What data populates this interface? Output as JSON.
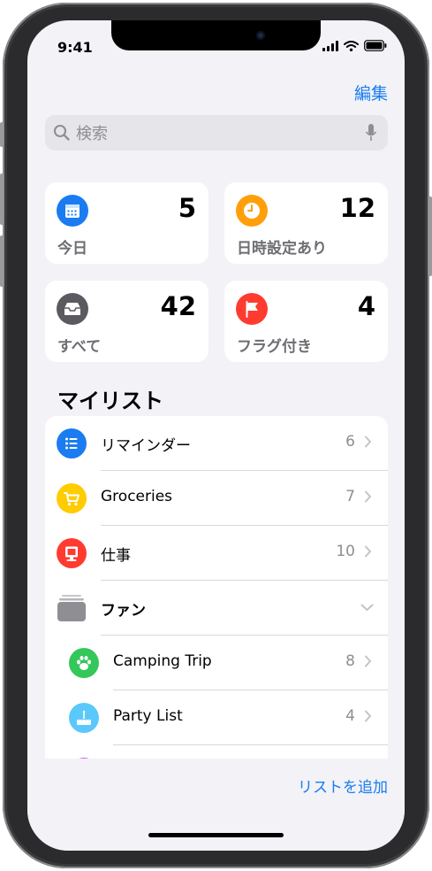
{
  "status_bar": {
    "time": "9:41"
  },
  "header": {
    "edit_label": "編集"
  },
  "search": {
    "placeholder": "検索"
  },
  "smart_lists": [
    {
      "label": "今日",
      "count": "5",
      "color": "#1a7cf0",
      "icon": "calendar-icon"
    },
    {
      "label": "日時設定あり",
      "count": "12",
      "color": "#ff9f0a",
      "icon": "clock-icon"
    },
    {
      "label": "すべて",
      "count": "42",
      "color": "#5a5a60",
      "icon": "tray-icon"
    },
    {
      "label": "フラグ付き",
      "count": "4",
      "color": "#ff3b30",
      "icon": "flag-icon"
    }
  ],
  "my_lists": {
    "title": "マイリスト",
    "items": [
      {
        "name": "リマインダー",
        "count": "6",
        "color": "#1a7cf0",
        "icon": "list-icon"
      },
      {
        "name": "Groceries",
        "count": "7",
        "color": "#ffcc00",
        "icon": "cart-icon"
      },
      {
        "name": "仕事",
        "count": "10",
        "color": "#ff3b30",
        "icon": "monitor-icon"
      }
    ],
    "group": {
      "name": "ファン",
      "icon": "folder-stack-icon",
      "items": [
        {
          "name": "Camping Trip",
          "count": "8",
          "color": "#34c759",
          "icon": "paw-icon"
        },
        {
          "name": "Party List",
          "count": "4",
          "color": "#5ac8fa",
          "icon": "cake-icon"
        }
      ]
    },
    "partial_item_color": "#bf5af2"
  },
  "footer": {
    "add_list_label": "リストを追加"
  }
}
